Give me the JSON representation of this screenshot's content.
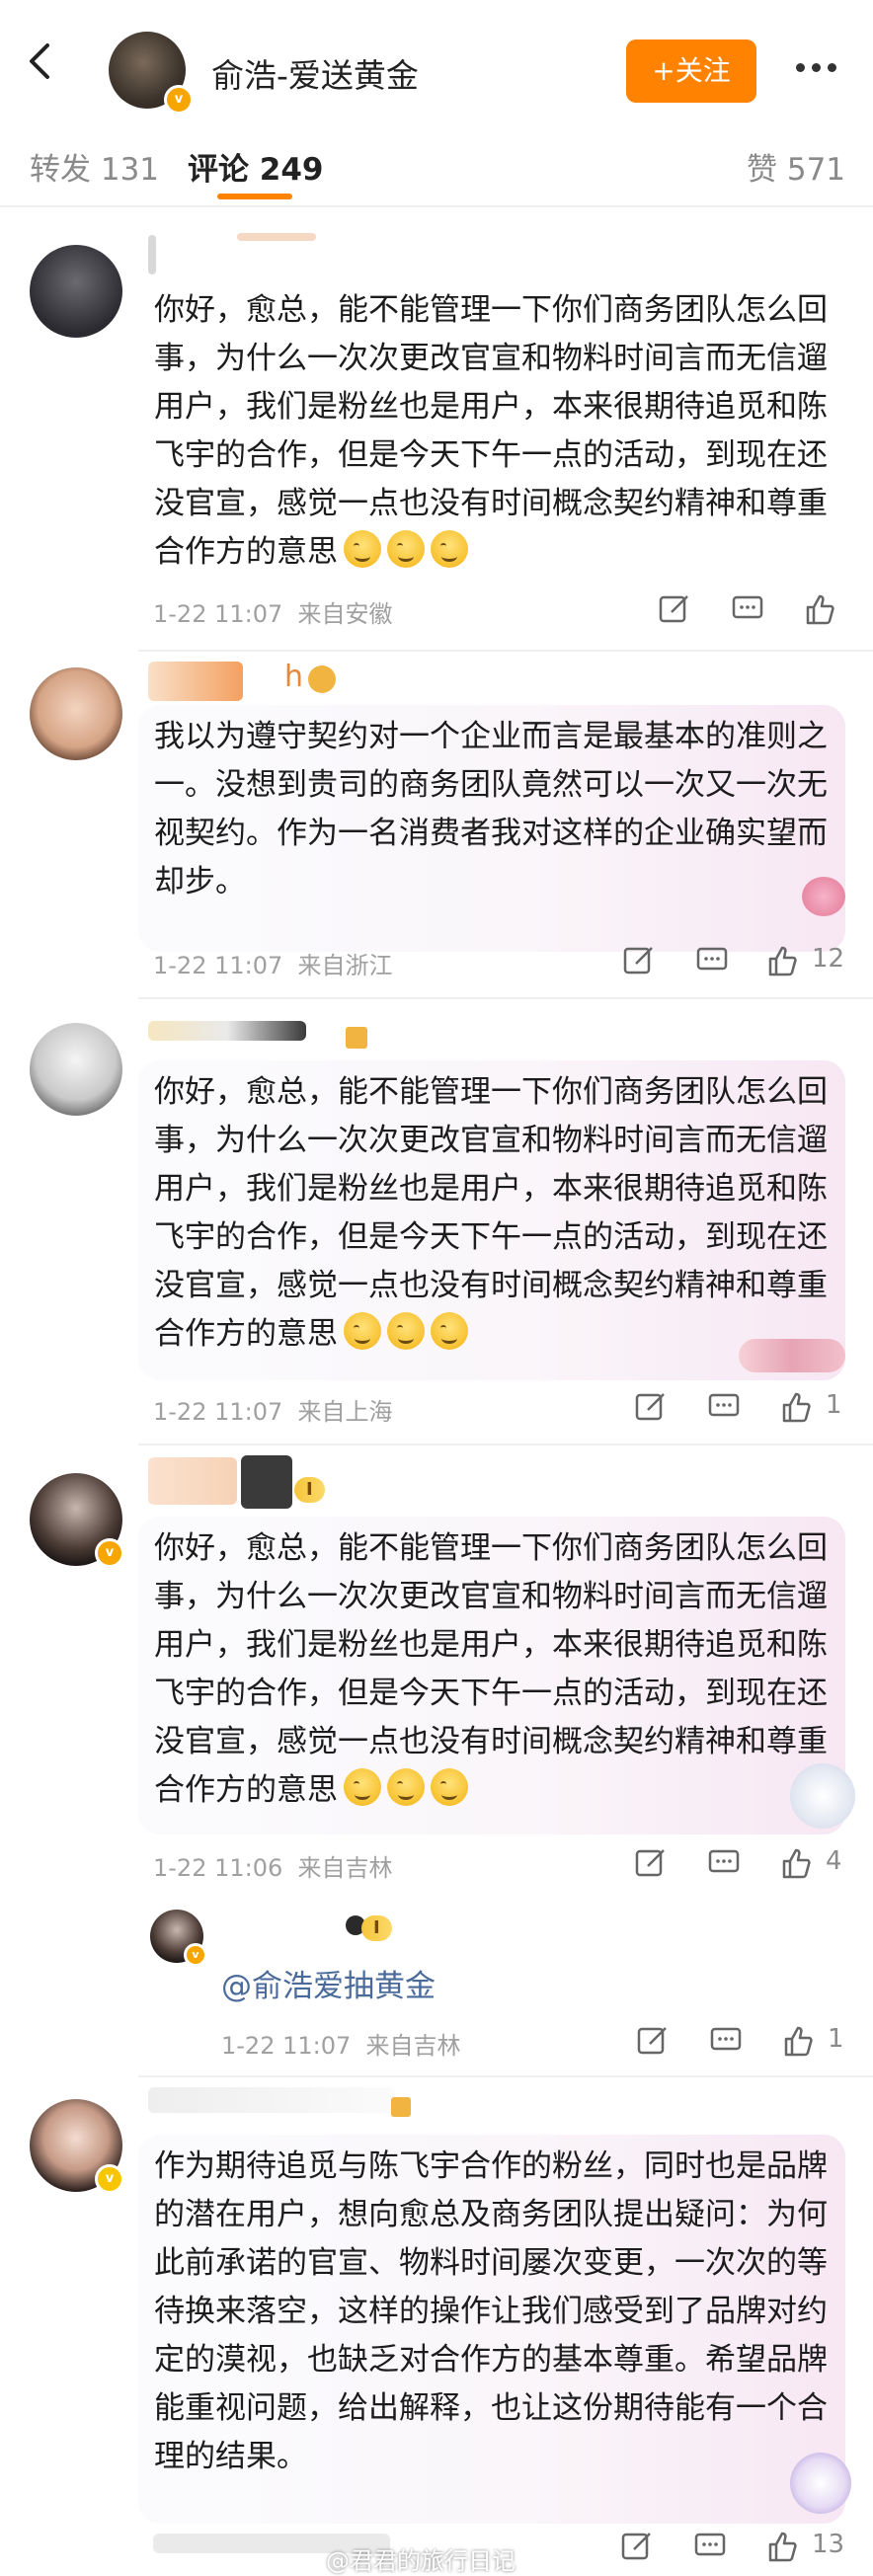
{
  "header": {
    "title": "俞浩-爱送黄金",
    "follow_label": "+关注",
    "more_label": "more"
  },
  "tabs": [
    {
      "label": "转发 131"
    },
    {
      "label": "评论 249"
    },
    {
      "label": "赞 571"
    }
  ],
  "comments": [
    {
      "username_hint": "",
      "text": "你好，愈总，能不能管理一下你们商务团队怎么回事，为什么一次次更改官宣和物料时间言而无信遛用户，我们是粉丝也是用户，本来很期待追觅和陈飞宇的合作，但是今天下午一点的活动，到现在还没官宣，感觉一点也没有时间概念契约精神和尊重合作方的意思",
      "time": "1-22 11:07",
      "location": "来自安徽",
      "likes": ""
    },
    {
      "username_hint": "h",
      "text": "我以为遵守契约对一个企业而言是最基本的准则之一。没想到贵司的商务团队竟然可以一次又一次无视契约。作为一名消费者我对这样的企业确实望而却步。",
      "time": "1-22 11:07",
      "location": "来自浙江",
      "likes": "12"
    },
    {
      "username_hint": "",
      "text": "你好，愈总，能不能管理一下你们商务团队怎么回事，为什么一次次更改官宣和物料时间言而无信遛用户，我们是粉丝也是用户，本来很期待追觅和陈飞宇的合作，但是今天下午一点的活动，到现在还没官宣，感觉一点也没有时间概念契约精神和尊重合作方的意思",
      "time": "1-22 11:07",
      "location": "来自上海",
      "likes": "1"
    },
    {
      "username_hint": "",
      "text": "你好，愈总，能不能管理一下你们商务团队怎么回事，为什么一次次更改官宣和物料时间言而无信遛用户，我们是粉丝也是用户，本来很期待追觅和陈飞宇的合作，但是今天下午一点的活动，到现在还没官宣，感觉一点也没有时间概念契约精神和尊重合作方的意思",
      "time": "1-22 11:06",
      "location": "来自吉林",
      "likes": "4"
    },
    {
      "username_hint": "",
      "text": "作为期待追觅与陈飞宇合作的粉丝，同时也是品牌的潜在用户，想向愈总及商务团队提出疑问：为何此前承诺的官宣、物料时间屡次变更，一次次的等待换来落空，这样的操作让我们感受到了品牌对约定的漠视，也缺乏对合作方的基本尊重。希望品牌能重视问题，给出解释，也让这份期待能有一个合理的结果。",
      "time": "",
      "location": "",
      "likes": "13"
    }
  ],
  "reply": {
    "mention": "@俞浩爱抽黄金",
    "time": "1-22 11:07",
    "location": "来自吉林",
    "likes": "1"
  },
  "level_badge": "I",
  "watermark": "@君君的旅行日记",
  "colors": {
    "accent": "#ff8200",
    "link": "#4a6a9a",
    "meta": "#a0a0a0"
  }
}
